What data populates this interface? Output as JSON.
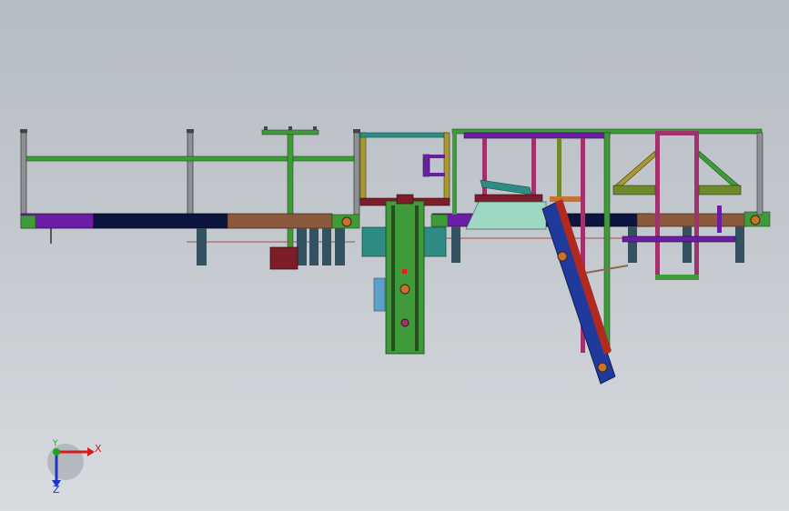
{
  "view": {
    "name": "cad-machine-front-view",
    "background_top": "#b6bcc3",
    "background_bottom": "#d8dbdf"
  },
  "colors": {
    "green": "#3f9a3a",
    "purple": "#6a1ea3",
    "navy": "#0c1440",
    "brown": "#8b5a3c",
    "grey_post": "#8e9096",
    "teal": "#2f8c84",
    "olive": "#6e8a2c",
    "magenta": "#a0336e",
    "blue_belt": "#1f3a9c",
    "red_belt": "#b02a20",
    "mint": "#9fd8c2",
    "maroon": "#7d1d2a",
    "slate_leg": "#33515e",
    "light_blue": "#5da0c8",
    "red_line": "#b14848"
  },
  "triad": {
    "x_label": "X",
    "y_label": "Y",
    "z_label": "Z",
    "x_color": "#d21e1e",
    "y_color": "#1ea51e",
    "z_color": "#1e32c8",
    "x_icon": "x-axis-arrow-icon",
    "y_icon": "y-axis-arrow-icon",
    "z_icon": "z-axis-arrow-icon"
  }
}
